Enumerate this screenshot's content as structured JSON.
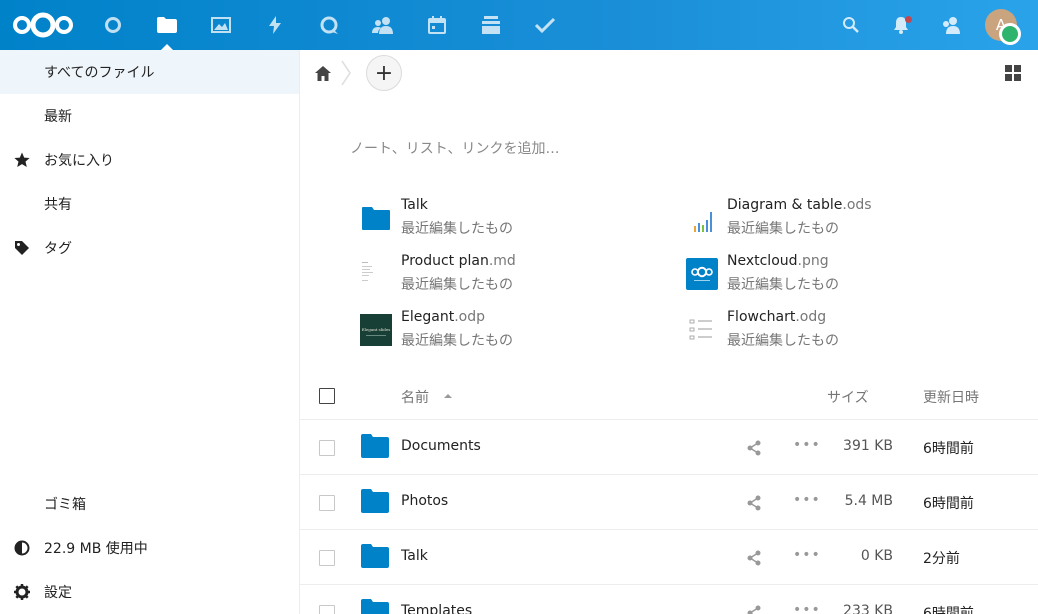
{
  "header": {
    "apps": [
      {
        "name": "dashboard-icon"
      },
      {
        "name": "files-icon"
      },
      {
        "name": "photos-icon"
      },
      {
        "name": "activity-icon"
      },
      {
        "name": "talk-icon"
      },
      {
        "name": "contacts-icon"
      },
      {
        "name": "calendar-icon"
      },
      {
        "name": "deck-icon"
      },
      {
        "name": "tasks-icon"
      }
    ],
    "avatar_initial": "A",
    "accent": "#0082c9"
  },
  "sidebar": {
    "items": [
      {
        "label": "すべてのファイル",
        "icon": "folder-icon"
      },
      {
        "label": "最新",
        "icon": "recent-icon"
      },
      {
        "label": "お気に入り",
        "icon": "star-icon"
      },
      {
        "label": "共有",
        "icon": "share-icon"
      },
      {
        "label": "タグ",
        "icon": "tag-icon"
      }
    ],
    "bottom": [
      {
        "label": "ゴミ箱",
        "icon": "trash-icon"
      },
      {
        "label": "22.9 MB 使用中",
        "icon": "quota-icon"
      },
      {
        "label": "設定",
        "icon": "settings-icon"
      }
    ]
  },
  "toolbar": {
    "add_label": "+"
  },
  "rich_workspace": {
    "placeholder": "ノート、リスト、リンクを追加…"
  },
  "recent": [
    {
      "name": "Talk",
      "ext": "",
      "sub": "最近編集したもの"
    },
    {
      "name": "Diagram & table",
      "ext": ".ods",
      "sub": "最近編集したもの"
    },
    {
      "name": "Product plan",
      "ext": ".md",
      "sub": "最近編集したもの"
    },
    {
      "name": "Nextcloud",
      "ext": ".png",
      "sub": "最近編集したもの"
    },
    {
      "name": "Elegant",
      "ext": ".odp",
      "sub": "最近編集したもの"
    },
    {
      "name": "Flowchart",
      "ext": ".odg",
      "sub": "最近編集したもの"
    }
  ],
  "thumb_text": {
    "elegant": "Elegant slides"
  },
  "list": {
    "col_name": "名前",
    "col_size": "サイズ",
    "col_modified": "更新日時",
    "rows": [
      {
        "name": "Documents",
        "size": "391 KB",
        "modified": "6時間前"
      },
      {
        "name": "Photos",
        "size": "5.4 MB",
        "modified": "6時間前"
      },
      {
        "name": "Talk",
        "size": "0 KB",
        "modified": "2分前"
      },
      {
        "name": "Templates",
        "size": "233 KB",
        "modified": "6時間前"
      }
    ]
  }
}
